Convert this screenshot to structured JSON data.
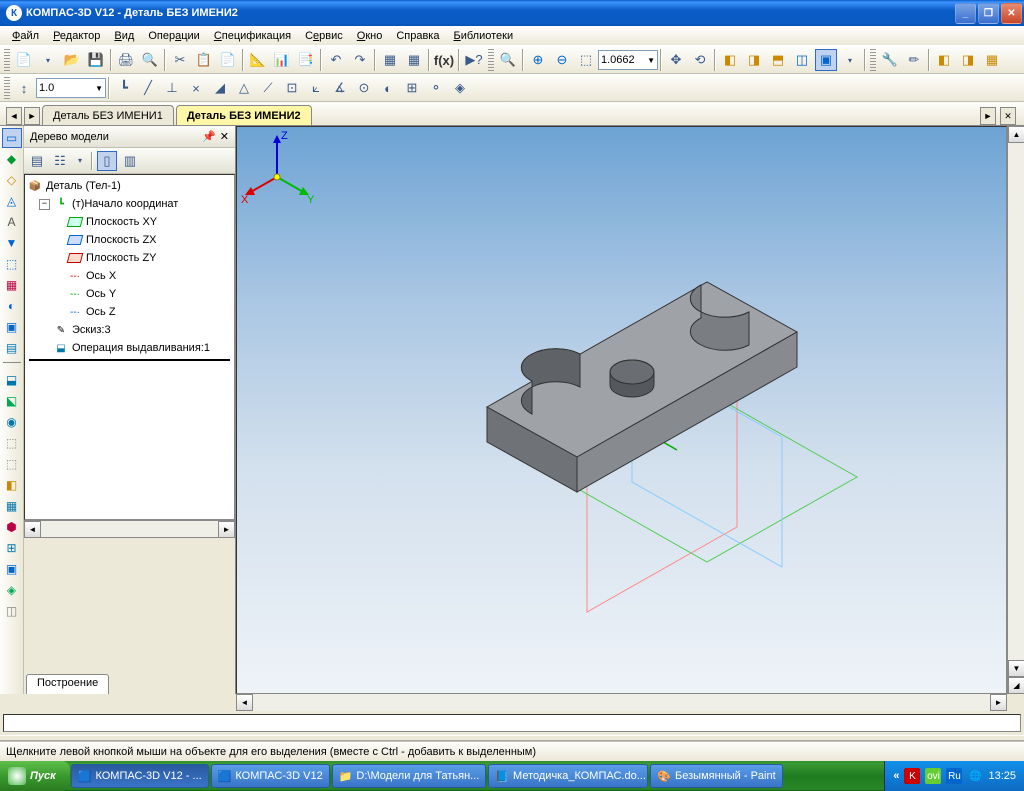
{
  "title": "КОМПАС-3D V12 - Деталь БЕЗ ИМЕНИ2",
  "menu": [
    "Файл",
    "Редактор",
    "Вид",
    "Операции",
    "Спецификация",
    "Сервис",
    "Окно",
    "Справка",
    "Библиотеки"
  ],
  "zoom_value": "1.0662",
  "scale_value": "1.0",
  "doc_tabs": [
    {
      "label": "Деталь БЕЗ ИМЕНИ1",
      "active": false
    },
    {
      "label": "Деталь БЕЗ ИМЕНИ2",
      "active": true
    }
  ],
  "tree": {
    "title": "Дерево модели",
    "root": "Деталь (Тел-1)",
    "origin": "(т)Начало координат",
    "planes": [
      "Плоскость XY",
      "Плоскость ZX",
      "Плоскость ZY"
    ],
    "axes": [
      "Ось X",
      "Ось Y",
      "Ось Z"
    ],
    "sketch": "Эскиз:3",
    "operation": "Операция выдавливания:1",
    "footer_tab": "Построение"
  },
  "triad": {
    "x": "X",
    "y": "Y",
    "z": "Z"
  },
  "status": "Щелкните левой кнопкой мыши на объекте для его выделения (вместе с Ctrl - добавить к выделенным)",
  "taskbar": {
    "start": "Пуск",
    "items": [
      "КОМПАС-3D V12 - ...",
      "КОМПАС-3D V12",
      "D:\\Модели для Татьян...",
      "Методичка_КОМПАС.do...",
      "Безымянный - Paint"
    ],
    "lang": "Ru",
    "time": "13:25"
  }
}
